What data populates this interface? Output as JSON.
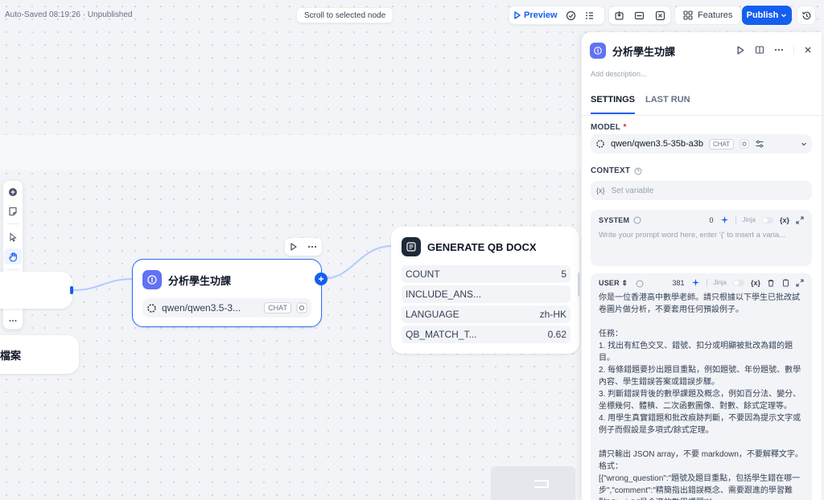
{
  "topbar": {
    "status": "Auto-Saved 08:19:26 · Unpublished",
    "scroll_to_node": "Scroll to selected node",
    "preview_label": "Preview",
    "features_label": "Features",
    "publish_label": "Publish"
  },
  "colors": {
    "accent": "#155eef",
    "llm_icon_bg": "#6172f3",
    "docx_icon_bg": "#1d2939",
    "canvas_bg": "#f2f4f7"
  },
  "canvas": {
    "partial_node_label": "檔案",
    "llm_node": {
      "title": "分析學生功課",
      "model": "qwen/qwen3.5-3...",
      "model_tag": "CHAT"
    },
    "docx_node": {
      "title": "GENERATE QB DOCX",
      "params": [
        {
          "key": "COUNT",
          "value": "5"
        },
        {
          "key": "INCLUDE_ANS...",
          "value": ""
        },
        {
          "key": "LANGUAGE",
          "value": "zh-HK"
        },
        {
          "key": "QB_MATCH_T...",
          "value": "0.62"
        }
      ]
    }
  },
  "panel": {
    "title": "分析學生功課",
    "description_placeholder": "Add description...",
    "tabs": [
      "SETTINGS",
      "LAST RUN"
    ],
    "model_label": "MODEL",
    "required_mark": "*",
    "model_value": "qwen/qwen3.5-35b-a3b",
    "model_tag": "CHAT",
    "context_label": "CONTEXT",
    "context_placeholder": "Set variable",
    "var_icon": "{x}",
    "system": {
      "label": "SYSTEM",
      "count": "0",
      "jinja": "Jinja",
      "placeholder": "Write your prompt word here, enter '{' to insert a varia..."
    },
    "user": {
      "label": "USER",
      "count": "381",
      "jinja": "Jinja",
      "text": "你是一位香港高中數學老師。請只根據以下學生已批改試卷圖片做分析，不要套用任何預設例子。\n\n任務：\n1. 找出有紅色交叉、錯號、扣分或明顯被批改為錯的題目。\n2. 每條錯題要抄出題目重點，例如題號、年份題號、數學內容、學生錯誤答案或錯誤步驟。\n3. 判斷錯誤背後的數學課題及概念，例如百分法、變分、坐標幾何、體積、二次函數圖像、對數、餘式定理等。\n4. 用學生真實錯題和批改痕跡判斷，不要因為提示文字或例子而假設是多項式/餘式定理。\n\n請只輸出 JSON array，不要 markdown，不要解釋文字。\n格式：\n[{\"wrong_question\":\"題號及題目重點，包括學生錯在哪一步\",\"comment\":\"精簡指出錯誤概念、需要跟進的學習難點\",\"topic\":\"最合適的數學課題\"}]"
    }
  }
}
